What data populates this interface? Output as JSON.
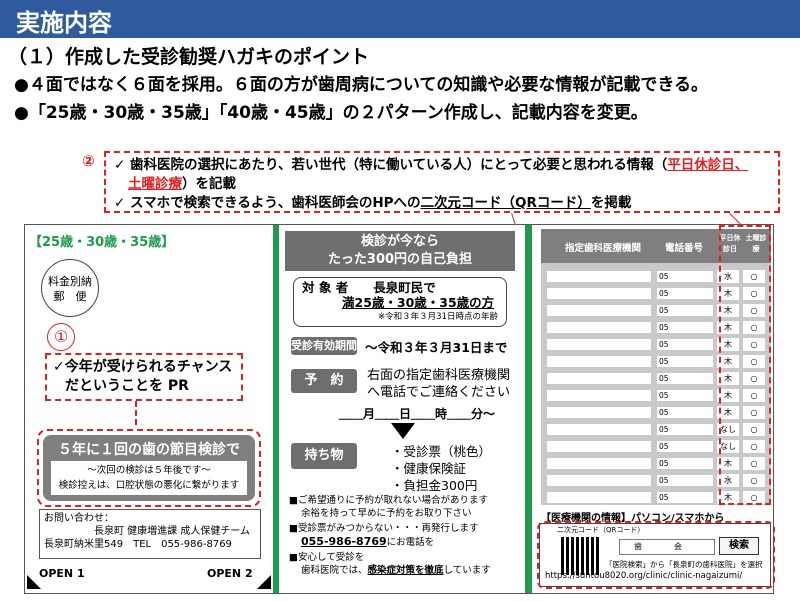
{
  "header": {
    "title": "実施内容"
  },
  "section": {
    "subtitle": "（１）作成した受診勧奨ハガキのポイント"
  },
  "bullets": [
    "●４面ではなく６面を採用。６面の方が歯周病についての知識や必要な情報が記載できる。",
    "●「25歳・30歳・35歳」「40歳・45歳」の２パターン作成し、記載内容を変更。"
  ],
  "note": {
    "marker": "②",
    "line1_a": "✓ 歯科医院の選択にあたり、若い世代（特に働いている人）にとって必要と思われる情報（",
    "line1_red": "平日休診日、",
    "line2_red": "土曜診療",
    "line2_b": "）を記載",
    "line3_a": "✓ スマホで検索できるよう、歯科医師会のHPへの",
    "line3_u": "二次元コード（QRコード）",
    "line3_b": "を掲載"
  },
  "panel1": {
    "age_label": "【25歳・30歳・35歳】",
    "stamp_line1": "料金別納",
    "stamp_line2": "郵　便",
    "marker": "①",
    "pr_line1": "✓今年が受けられるチャンス",
    "pr_line2": "だということを PR",
    "checkup_title": "５年に１回の歯の節目検診です！",
    "checkup_line1": "～次回の検診は５年後です～",
    "checkup_line2": "検診控えは、口腔状態の悪化に繋がります",
    "contact_line1": "お問い合わせ：",
    "contact_line2": "長泉町 健康増進課 成人保健チーム",
    "contact_line3": "長泉町納米里549　TEL　055-986-8769",
    "open1": "OPEN 1",
    "open2": "OPEN 2"
  },
  "panel2": {
    "head_line1": "検診が今なら",
    "head_line2": "たった300円の自己負担",
    "target_label": "対 象 者　　長泉町民で",
    "target_ages": "満25歳・30歳・35歳の方",
    "target_note": "※令和３年３月31日時点の年齢",
    "valid_badge": "受診有効期間",
    "valid_text": "～令和３年３月31日まで",
    "reserve_badge": "予　約",
    "reserve_line1": "右面の指定歯科医療機関",
    "reserve_line2": "へ電話でご連絡ください",
    "date_blank": "＿＿月＿＿日＿＿時＿＿分～",
    "items_badge": "持ち物",
    "items": [
      "・受診票（桃色）",
      "・健康保険証",
      "・負担金300円"
    ],
    "note1a": "■ご希望通りに予約が取れない場合があります",
    "note1b": "余裕を持って早めに予約をお取り下さい",
    "note2a": "■受診票がみつからない・・・再発行します",
    "note2b": "055-986-8769",
    "note2c": "にお電話を",
    "note3a": "■安心して受診を",
    "note3b": "歯科医院では、",
    "note3c": "感染症対策を徹底",
    "note3d": "しています"
  },
  "panel3": {
    "col_name": "指定歯科医療機関",
    "col_phone": "電話番号",
    "col_weekday": "平日休診日",
    "col_sat": "土曜診療",
    "rows": [
      {
        "phone": "05",
        "weekday": "水",
        "sat": "○"
      },
      {
        "phone": "05",
        "weekday": "木",
        "sat": "○"
      },
      {
        "phone": "05",
        "weekday": "木",
        "sat": "○"
      },
      {
        "phone": "05",
        "weekday": "木",
        "sat": "○"
      },
      {
        "phone": "05",
        "weekday": "木",
        "sat": "○"
      },
      {
        "phone": "05",
        "weekday": "木",
        "sat": "○"
      },
      {
        "phone": "05",
        "weekday": "木",
        "sat": "○"
      },
      {
        "phone": "05",
        "weekday": "木",
        "sat": "○"
      },
      {
        "phone": "05",
        "weekday": "木",
        "sat": "○"
      },
      {
        "phone": "05",
        "weekday": "なし",
        "sat": "○"
      },
      {
        "phone": "05",
        "weekday": "なし",
        "sat": "○"
      },
      {
        "phone": "05",
        "weekday": "木",
        "sat": "○"
      },
      {
        "phone": "05",
        "weekday": "水",
        "sat": "○"
      },
      {
        "phone": "05",
        "weekday": "木",
        "sat": "○"
      }
    ],
    "pc_label": "【医療機関の情報】パソコン/スマホから",
    "qr_label": "二次元コード（QRコード）",
    "search_text": "歯　　　　会",
    "search_button": "検索",
    "help_text": "「医院検索」から「長泉町の歯科医院」を選択",
    "url": "https://suntou8020.org/clinic/clinic-nagaizumi/"
  },
  "colors": {
    "header": "#2f5a9e",
    "accent": "#e02020",
    "green": "#1f9a4f"
  }
}
